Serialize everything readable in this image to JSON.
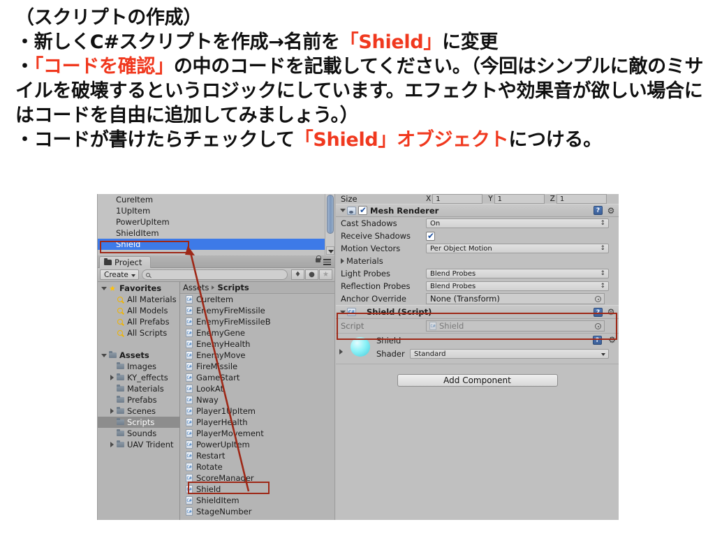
{
  "slide": {
    "lines": [
      {
        "segments": [
          {
            "text": "（スクリプトの作成）",
            "color": "black"
          }
        ]
      },
      {
        "segments": [
          {
            "text": "・新しくC#スクリプトを作成→名前を",
            "color": "black"
          },
          {
            "text": "「Shield」",
            "color": "red"
          },
          {
            "text": "に変更",
            "color": "black"
          }
        ]
      },
      {
        "segments": [
          {
            "text": "・",
            "color": "black"
          },
          {
            "text": "「コードを確認」",
            "color": "red"
          },
          {
            "text": "の中のコードを記載してください。（今回はシンプルに敵のミサイルを破壊するというロジックにしています。エフェクトや効果音が欲しい場合にはコードを自由に追加してみましょう。）",
            "color": "black"
          }
        ]
      },
      {
        "segments": [
          {
            "text": "・コードが書けたらチェックして",
            "color": "black"
          },
          {
            "text": "「Shield」オブジェクト",
            "color": "red"
          },
          {
            "text": "につける。",
            "color": "black"
          }
        ]
      }
    ],
    "accent_red": "#f0381e",
    "body_black": "#0f0f0f"
  },
  "unity": {
    "hierarchy": {
      "items": [
        {
          "label": "CureItem",
          "selected": false
        },
        {
          "label": "1UpItem",
          "selected": false
        },
        {
          "label": "PowerUpItem",
          "selected": false
        },
        {
          "label": "ShieldItem",
          "selected": false
        },
        {
          "label": "Shield",
          "selected": true
        }
      ],
      "selection_color": "#3d7ae8"
    },
    "project": {
      "tab_label": "Project",
      "create_button": "Create",
      "search_placeholder": "",
      "toolbar_icons": [
        "filter-by-type-icon",
        "filter-by-label-icon",
        "favorite-star-icon"
      ],
      "tree": [
        {
          "label": "Favorites",
          "indent": 0,
          "icon": "star-icon",
          "triangle": "open",
          "bold": true,
          "selected": false
        },
        {
          "label": "All Materials",
          "indent": 1,
          "icon": "search-icon",
          "triangle": "none",
          "bold": false,
          "selected": false
        },
        {
          "label": "All Models",
          "indent": 1,
          "icon": "search-icon",
          "triangle": "none",
          "bold": false,
          "selected": false
        },
        {
          "label": "All Prefabs",
          "indent": 1,
          "icon": "search-icon",
          "triangle": "none",
          "bold": false,
          "selected": false
        },
        {
          "label": "All Scripts",
          "indent": 1,
          "icon": "search-icon",
          "triangle": "none",
          "bold": false,
          "selected": false
        },
        {
          "label": "",
          "indent": 0,
          "icon": "none",
          "triangle": "none",
          "bold": false,
          "selected": false
        },
        {
          "label": "Assets",
          "indent": 0,
          "icon": "folder-icon",
          "triangle": "open",
          "bold": true,
          "selected": false
        },
        {
          "label": "Images",
          "indent": 1,
          "icon": "folder-icon",
          "triangle": "none",
          "bold": false,
          "selected": false
        },
        {
          "label": "KY_effects",
          "indent": 1,
          "icon": "folder-icon",
          "triangle": "closed",
          "bold": false,
          "selected": false
        },
        {
          "label": "Materials",
          "indent": 1,
          "icon": "folder-icon",
          "triangle": "none",
          "bold": false,
          "selected": false
        },
        {
          "label": "Prefabs",
          "indent": 1,
          "icon": "folder-icon",
          "triangle": "none",
          "bold": false,
          "selected": false
        },
        {
          "label": "Scenes",
          "indent": 1,
          "icon": "folder-icon",
          "triangle": "closed",
          "bold": false,
          "selected": false
        },
        {
          "label": "Scripts",
          "indent": 1,
          "icon": "folder-icon",
          "triangle": "none",
          "bold": false,
          "selected": true
        },
        {
          "label": "Sounds",
          "indent": 1,
          "icon": "folder-icon",
          "triangle": "none",
          "bold": false,
          "selected": false
        },
        {
          "label": "UAV Trident",
          "indent": 1,
          "icon": "folder-icon",
          "triangle": "closed",
          "bold": false,
          "selected": false
        }
      ],
      "breadcrumb": {
        "root": "Assets",
        "current": "Scripts"
      },
      "files": [
        "CureItem",
        "EnemyFireMissile",
        "EnemyFireMissileB",
        "EnemyGene",
        "EnemyHealth",
        "EnemyMove",
        "FireMissile",
        "GameStart",
        "LookAt",
        "Nway",
        "Player1UpItem",
        "PlayerHealth",
        "PlayerMovement",
        "PowerUpItem",
        "Restart",
        "Rotate",
        "ScoreManager",
        "Shield",
        "ShieldItem",
        "StageNumber"
      ],
      "highlighted_file": "Shield"
    },
    "inspector": {
      "size_row": {
        "label": "Size",
        "x_axis": "X",
        "x": "1",
        "y_axis": "Y",
        "y": "1",
        "z_axis": "Z",
        "z": "1"
      },
      "mesh_renderer": {
        "title": "Mesh Renderer",
        "enabled": true,
        "fields": [
          {
            "label": "Cast Shadows",
            "type": "dropdown",
            "value": "On"
          },
          {
            "label": "Receive Shadows",
            "type": "checkbox",
            "value": true
          },
          {
            "label": "Motion Vectors",
            "type": "dropdown",
            "value": "Per Object Motion"
          },
          {
            "label": "Materials",
            "type": "foldout",
            "value": ""
          },
          {
            "label": "Light Probes",
            "type": "dropdown",
            "value": "Blend Probes"
          },
          {
            "label": "Reflection Probes",
            "type": "dropdown",
            "value": "Blend Probes"
          },
          {
            "label": "Anchor Override",
            "type": "object",
            "value": "None (Transform)"
          }
        ]
      },
      "shield_script": {
        "title": "Shield (Script)",
        "script_label": "Script",
        "script_value": "Shield"
      },
      "material": {
        "name": "Shield",
        "shader_label": "Shader",
        "shader_value": "Standard",
        "preview_color": "#8df2f7"
      },
      "add_component": "Add Component"
    },
    "annotation_color": "#9e2817"
  }
}
